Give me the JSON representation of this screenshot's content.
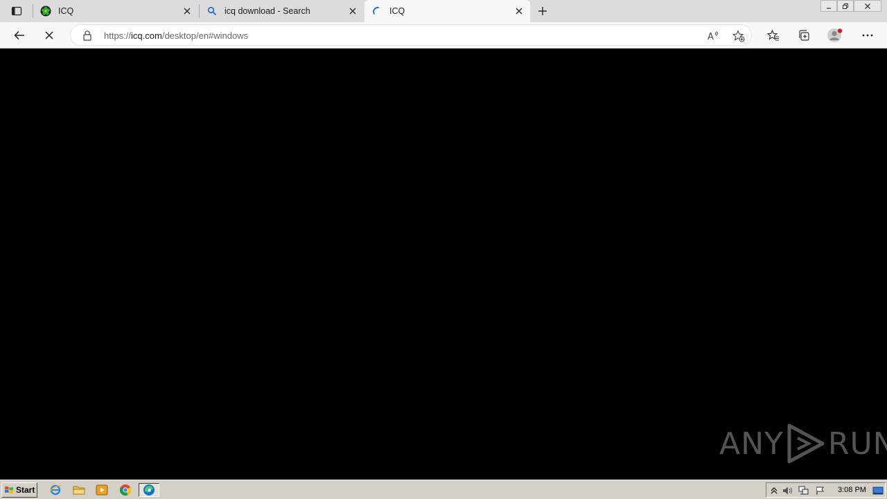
{
  "tabs": [
    {
      "title": "ICQ",
      "close_label": "×"
    },
    {
      "title": "icq download - Search",
      "close_label": "×"
    },
    {
      "title": "ICQ",
      "close_label": "×"
    }
  ],
  "omnibox": {
    "url_scheme": "https://",
    "url_host": "icq.com",
    "url_path": "/desktop/en#windows"
  },
  "watermark": {
    "left": "ANY",
    "right": "RUN"
  },
  "taskbar": {
    "start_label": "Start",
    "clock": "3:08 PM"
  },
  "colors": {
    "tabstrip": "#dcdcdc",
    "toolbar": "#f7f7f7",
    "content": "#000000",
    "taskbar": "#d4d0c8",
    "icq_green": "#2db43b",
    "profile_dot": "#e0142a"
  }
}
